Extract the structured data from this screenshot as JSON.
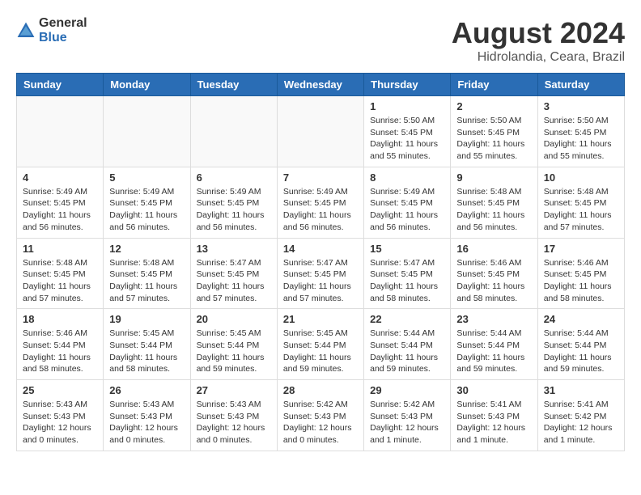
{
  "header": {
    "logo_general": "General",
    "logo_blue": "Blue",
    "title": "August 2024",
    "location": "Hidrolandia, Ceara, Brazil"
  },
  "days_of_week": [
    "Sunday",
    "Monday",
    "Tuesday",
    "Wednesday",
    "Thursday",
    "Friday",
    "Saturday"
  ],
  "weeks": [
    [
      {
        "day": "",
        "info": ""
      },
      {
        "day": "",
        "info": ""
      },
      {
        "day": "",
        "info": ""
      },
      {
        "day": "",
        "info": ""
      },
      {
        "day": "1",
        "info": "Sunrise: 5:50 AM\nSunset: 5:45 PM\nDaylight: 11 hours\nand 55 minutes."
      },
      {
        "day": "2",
        "info": "Sunrise: 5:50 AM\nSunset: 5:45 PM\nDaylight: 11 hours\nand 55 minutes."
      },
      {
        "day": "3",
        "info": "Sunrise: 5:50 AM\nSunset: 5:45 PM\nDaylight: 11 hours\nand 55 minutes."
      }
    ],
    [
      {
        "day": "4",
        "info": "Sunrise: 5:49 AM\nSunset: 5:45 PM\nDaylight: 11 hours\nand 56 minutes."
      },
      {
        "day": "5",
        "info": "Sunrise: 5:49 AM\nSunset: 5:45 PM\nDaylight: 11 hours\nand 56 minutes."
      },
      {
        "day": "6",
        "info": "Sunrise: 5:49 AM\nSunset: 5:45 PM\nDaylight: 11 hours\nand 56 minutes."
      },
      {
        "day": "7",
        "info": "Sunrise: 5:49 AM\nSunset: 5:45 PM\nDaylight: 11 hours\nand 56 minutes."
      },
      {
        "day": "8",
        "info": "Sunrise: 5:49 AM\nSunset: 5:45 PM\nDaylight: 11 hours\nand 56 minutes."
      },
      {
        "day": "9",
        "info": "Sunrise: 5:48 AM\nSunset: 5:45 PM\nDaylight: 11 hours\nand 56 minutes."
      },
      {
        "day": "10",
        "info": "Sunrise: 5:48 AM\nSunset: 5:45 PM\nDaylight: 11 hours\nand 57 minutes."
      }
    ],
    [
      {
        "day": "11",
        "info": "Sunrise: 5:48 AM\nSunset: 5:45 PM\nDaylight: 11 hours\nand 57 minutes."
      },
      {
        "day": "12",
        "info": "Sunrise: 5:48 AM\nSunset: 5:45 PM\nDaylight: 11 hours\nand 57 minutes."
      },
      {
        "day": "13",
        "info": "Sunrise: 5:47 AM\nSunset: 5:45 PM\nDaylight: 11 hours\nand 57 minutes."
      },
      {
        "day": "14",
        "info": "Sunrise: 5:47 AM\nSunset: 5:45 PM\nDaylight: 11 hours\nand 57 minutes."
      },
      {
        "day": "15",
        "info": "Sunrise: 5:47 AM\nSunset: 5:45 PM\nDaylight: 11 hours\nand 58 minutes."
      },
      {
        "day": "16",
        "info": "Sunrise: 5:46 AM\nSunset: 5:45 PM\nDaylight: 11 hours\nand 58 minutes."
      },
      {
        "day": "17",
        "info": "Sunrise: 5:46 AM\nSunset: 5:45 PM\nDaylight: 11 hours\nand 58 minutes."
      }
    ],
    [
      {
        "day": "18",
        "info": "Sunrise: 5:46 AM\nSunset: 5:44 PM\nDaylight: 11 hours\nand 58 minutes."
      },
      {
        "day": "19",
        "info": "Sunrise: 5:45 AM\nSunset: 5:44 PM\nDaylight: 11 hours\nand 58 minutes."
      },
      {
        "day": "20",
        "info": "Sunrise: 5:45 AM\nSunset: 5:44 PM\nDaylight: 11 hours\nand 59 minutes."
      },
      {
        "day": "21",
        "info": "Sunrise: 5:45 AM\nSunset: 5:44 PM\nDaylight: 11 hours\nand 59 minutes."
      },
      {
        "day": "22",
        "info": "Sunrise: 5:44 AM\nSunset: 5:44 PM\nDaylight: 11 hours\nand 59 minutes."
      },
      {
        "day": "23",
        "info": "Sunrise: 5:44 AM\nSunset: 5:44 PM\nDaylight: 11 hours\nand 59 minutes."
      },
      {
        "day": "24",
        "info": "Sunrise: 5:44 AM\nSunset: 5:44 PM\nDaylight: 11 hours\nand 59 minutes."
      }
    ],
    [
      {
        "day": "25",
        "info": "Sunrise: 5:43 AM\nSunset: 5:43 PM\nDaylight: 12 hours\nand 0 minutes."
      },
      {
        "day": "26",
        "info": "Sunrise: 5:43 AM\nSunset: 5:43 PM\nDaylight: 12 hours\nand 0 minutes."
      },
      {
        "day": "27",
        "info": "Sunrise: 5:43 AM\nSunset: 5:43 PM\nDaylight: 12 hours\nand 0 minutes."
      },
      {
        "day": "28",
        "info": "Sunrise: 5:42 AM\nSunset: 5:43 PM\nDaylight: 12 hours\nand 0 minutes."
      },
      {
        "day": "29",
        "info": "Sunrise: 5:42 AM\nSunset: 5:43 PM\nDaylight: 12 hours\nand 1 minute."
      },
      {
        "day": "30",
        "info": "Sunrise: 5:41 AM\nSunset: 5:43 PM\nDaylight: 12 hours\nand 1 minute."
      },
      {
        "day": "31",
        "info": "Sunrise: 5:41 AM\nSunset: 5:42 PM\nDaylight: 12 hours\nand 1 minute."
      }
    ]
  ]
}
